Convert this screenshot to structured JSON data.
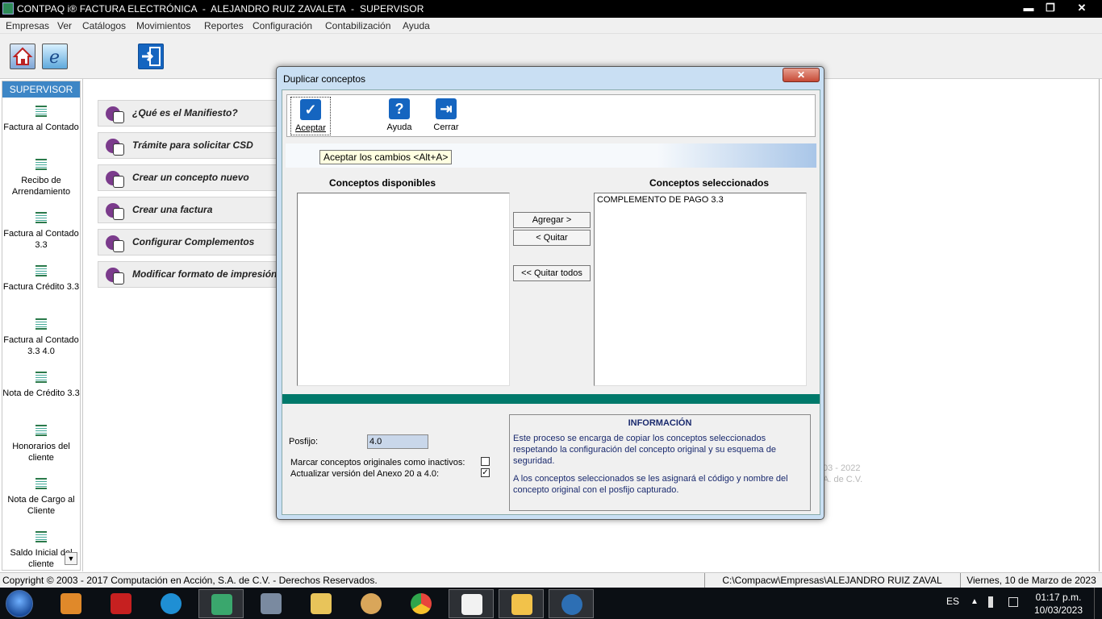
{
  "window": {
    "title": "CONTPAQ i® FACTURA ELECTRÓNICA  -  ALEJANDRO RUIZ ZAVALETA  -  SUPERVISOR",
    "min_glyph": "▬",
    "max_glyph": "❐",
    "close_glyph": "✕"
  },
  "menubar": {
    "items": [
      "Empresas",
      "Ver",
      "Catálogos",
      "Movimientos",
      "Reportes",
      "Configuración",
      "Contabilización",
      "Ayuda"
    ]
  },
  "toolbar": {
    "icons": [
      "home-icon",
      "web-icon",
      "exit-icon"
    ]
  },
  "sidebar": {
    "header": "SUPERVISOR",
    "items": [
      {
        "label": "Factura al Contado",
        "icon": "document-icon"
      },
      {
        "label": "Recibo de Arrendamiento",
        "icon": "document-icon"
      },
      {
        "label": "Factura al Contado 3.3",
        "icon": "document-icon"
      },
      {
        "label": "Factura Crédito 3.3",
        "icon": "document-icon"
      },
      {
        "label": "Factura al Contado 3.3 4.0",
        "icon": "document-icon"
      },
      {
        "label": "Nota de Crédito 3.3",
        "icon": "document-icon"
      },
      {
        "label": "Honorarios del cliente",
        "icon": "document-icon"
      },
      {
        "label": "Nota de Cargo al Cliente",
        "icon": "document-icon"
      },
      {
        "label": "Saldo Inicial del cliente",
        "icon": "document-icon"
      }
    ],
    "scroll_glyph": "▼"
  },
  "main": {
    "links": [
      "¿Qué es el Manifiesto?",
      "Trámite para solicitar CSD",
      "Crear un concepto nuevo",
      "Crear una factura",
      "Configurar Complementos",
      "Modificar formato de impresión"
    ],
    "faded_copyright_line1": "03 - 2022",
    "faded_copyright_line2": "A. de C.V."
  },
  "dialog": {
    "title": "Duplicar conceptos",
    "close_glyph": "✕",
    "tools": {
      "accept": "Aceptar",
      "help": "Ayuda",
      "close": "Cerrar",
      "accept_glyph": "✓",
      "help_glyph": "?",
      "close_glyph": "⇥"
    },
    "tooltip": "Aceptar los cambios <Alt+A>",
    "available_header": "Conceptos disponibles",
    "selected_header": "Conceptos seleccionados",
    "available_items": [],
    "selected_items": [
      "COMPLEMENTO DE PAGO 3.3"
    ],
    "buttons": {
      "add": "Agregar >",
      "remove": "< Quitar",
      "remove_all": "<< Quitar todos"
    },
    "postfix_label": "Posfijo:",
    "postfix_value": "4.0",
    "checkboxes": {
      "mark_inactive_label": "Marcar conceptos originales como inactivos:",
      "mark_inactive_checked": false,
      "update_annex_label": "Actualizar versión del Anexo 20 a 4.0:",
      "update_annex_checked": true,
      "check_glyph": "✓"
    },
    "info": {
      "title": "INFORMACIÓN",
      "p1": "Este proceso se encarga de copiar los conceptos seleccionados respetando la configuración del concepto original y su esquema de seguridad.",
      "p2": "A los conceptos seleccionados se les asignará el código y nombre del concepto original con el posfijo capturado."
    }
  },
  "statusbar": {
    "copyright": "Copyright © 2003 - 2017 Computación en Acción, S.A. de C.V. - Derechos Reservados.",
    "path": "C:\\Compacw\\Empresas\\ALEJANDRO RUIZ ZAVAL",
    "date": "Viernes, 10 de Marzo de 2023"
  },
  "taskbar": {
    "apps": [
      {
        "name": "media-player-icon",
        "color": "#e0892a"
      },
      {
        "name": "pdf-reader-icon",
        "color": "#c62020"
      },
      {
        "name": "edge-icon",
        "color": "#1f8fd4"
      },
      {
        "name": "contpaq-icon",
        "color": "#3aa76d"
      },
      {
        "name": "calculator-icon",
        "color": "#7a8aa0"
      },
      {
        "name": "file-explorer-icon",
        "color": "#e8c45a"
      },
      {
        "name": "paint-icon",
        "color": "#d9a65a"
      },
      {
        "name": "chrome-icon",
        "color": "#e8453c"
      },
      {
        "name": "chart-app-icon",
        "color": "#f2f2f2"
      },
      {
        "name": "slides-app-icon",
        "color": "#f2c24a"
      },
      {
        "name": "triangle-app-icon",
        "color": "#2d6fb4"
      }
    ],
    "lang": "ES",
    "tray_arrow": "▲",
    "time": "01:17 p.m.",
    "date": "10/03/2023"
  }
}
